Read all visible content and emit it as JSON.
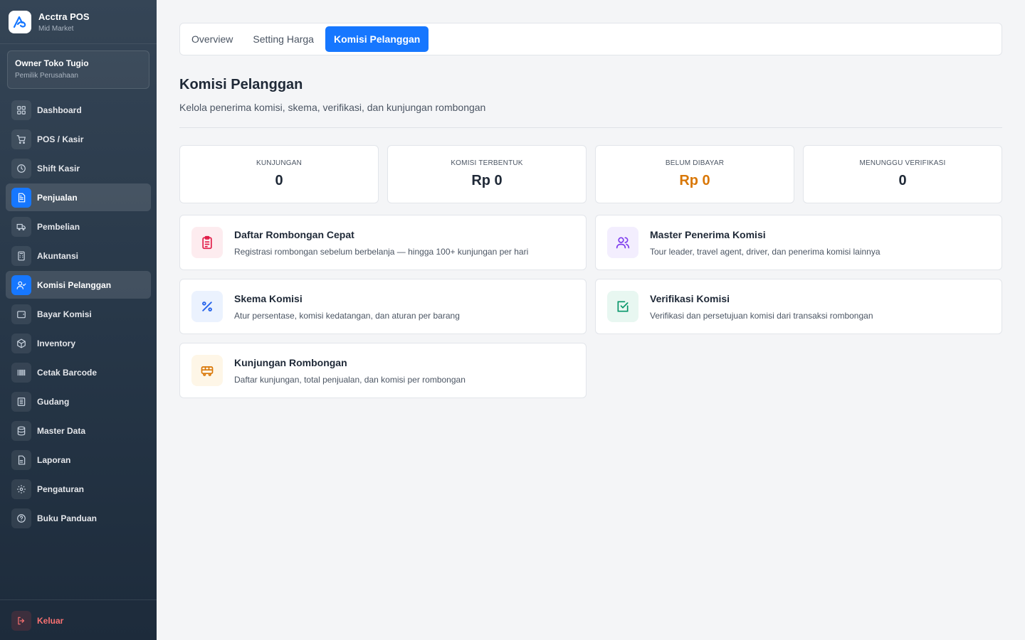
{
  "brand": {
    "name": "Acctra POS",
    "subtitle": "Mid Market"
  },
  "user": {
    "name": "Owner Toko Tugio",
    "role": "Pemilik Perusahaan"
  },
  "sidebar": {
    "items": [
      {
        "label": "Dashboard",
        "icon": "grid-icon"
      },
      {
        "label": "POS / Kasir",
        "icon": "cart-icon"
      },
      {
        "label": "Shift Kasir",
        "icon": "clock-icon"
      },
      {
        "label": "Penjualan",
        "icon": "document-icon"
      },
      {
        "label": "Pembelian",
        "icon": "truck-icon"
      },
      {
        "label": "Akuntansi",
        "icon": "calculator-icon"
      },
      {
        "label": "Komisi Pelanggan",
        "icon": "user-check-icon"
      },
      {
        "label": "Bayar Komisi",
        "icon": "wallet-icon"
      },
      {
        "label": "Inventory",
        "icon": "box-icon"
      },
      {
        "label": "Cetak Barcode",
        "icon": "barcode-icon"
      },
      {
        "label": "Gudang",
        "icon": "warehouse-icon"
      },
      {
        "label": "Master Data",
        "icon": "database-icon"
      },
      {
        "label": "Laporan",
        "icon": "report-icon"
      },
      {
        "label": "Pengaturan",
        "icon": "gear-icon"
      },
      {
        "label": "Buku Panduan",
        "icon": "help-icon"
      }
    ],
    "logout": "Keluar"
  },
  "tabs": [
    "Overview",
    "Setting Harga",
    "Komisi Pelanggan"
  ],
  "page": {
    "title": "Komisi Pelanggan",
    "subtitle": "Kelola penerima komisi, skema, verifikasi, dan kunjungan rombongan"
  },
  "stats": [
    {
      "label": "KUNJUNGAN",
      "value": "0"
    },
    {
      "label": "KOMISI TERBENTUK",
      "value": "Rp 0"
    },
    {
      "label": "BELUM DIBAYAR",
      "value": "Rp 0",
      "color": "#d97706"
    },
    {
      "label": "MENUNGGU VERIFIKASI",
      "value": "0"
    }
  ],
  "cards": [
    {
      "title": "Daftar Rombongan Cepat",
      "desc": "Registrasi rombongan sebelum berbelanja — hingga 100+ kunjungan per hari",
      "icon": "clipboard-list-icon",
      "accent": "#e11d48"
    },
    {
      "title": "Master Penerima Komisi",
      "desc": "Tour leader, travel agent, driver, dan penerima komisi lainnya",
      "icon": "users-icon",
      "accent": "#7c3aed"
    },
    {
      "title": "Skema Komisi",
      "desc": "Atur persentase, komisi kedatangan, dan aturan per barang",
      "icon": "percent-icon",
      "accent": "#2563eb"
    },
    {
      "title": "Verifikasi Komisi",
      "desc": "Verifikasi dan persetujuan komisi dari transaksi rombongan",
      "icon": "check-square-icon",
      "accent": "#059669"
    },
    {
      "title": "Kunjungan Rombongan",
      "desc": "Daftar kunjungan, total penjualan, dan komisi per rombongan",
      "icon": "bus-icon",
      "accent": "#d97706"
    }
  ],
  "colors": {
    "primary": "#1677ff",
    "sidebar_top": "#354556",
    "sidebar_bottom": "#1d2b3b",
    "danger": "#f87171"
  }
}
